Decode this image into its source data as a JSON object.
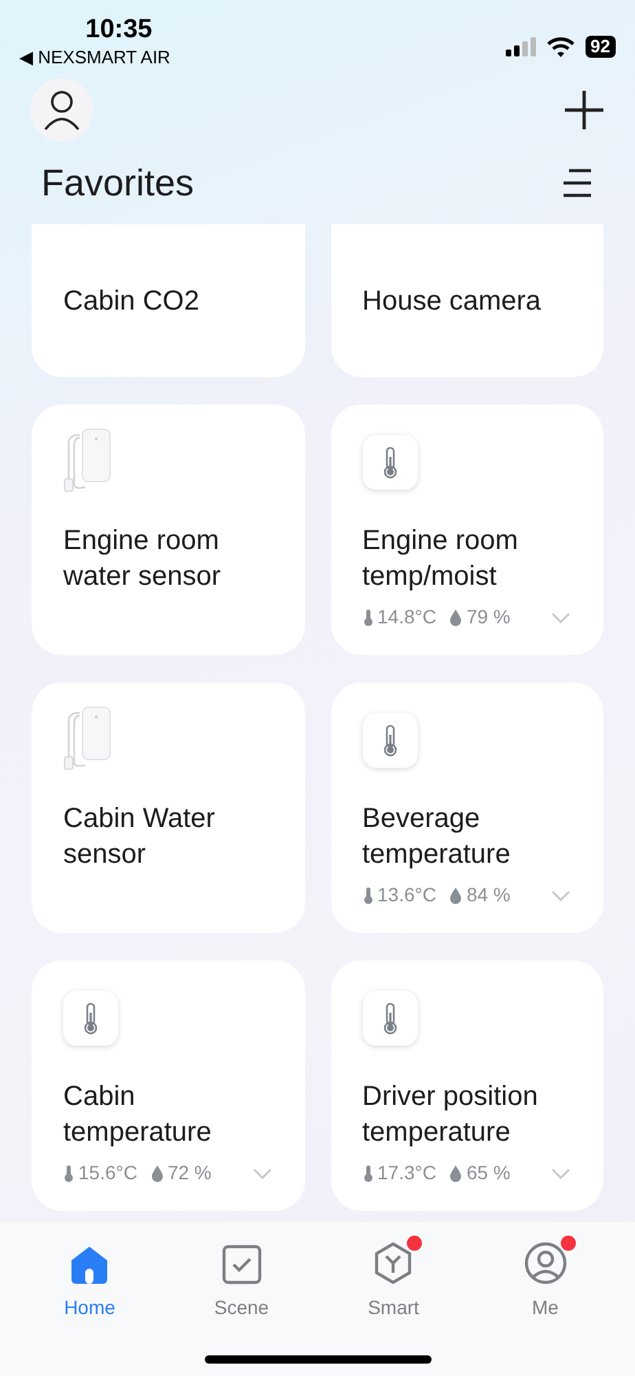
{
  "status_bar": {
    "time": "10:35",
    "back_label": "◀ NEXSMART AIR",
    "battery": "92"
  },
  "header": {
    "title": "Favorites"
  },
  "devices": [
    {
      "name": "Cabin CO2",
      "kind": "plain",
      "clipped": true
    },
    {
      "name": "House camera",
      "kind": "plain",
      "clipped": true
    },
    {
      "name": "Engine room water sensor",
      "kind": "water",
      "clipped": false
    },
    {
      "name": "Engine room temp/moist",
      "kind": "thermo",
      "clipped": false,
      "temperature": "14.8°C",
      "humidity": "79 %"
    },
    {
      "name": "Cabin Water sensor",
      "kind": "water",
      "clipped": false
    },
    {
      "name": "Beverage temperature",
      "kind": "thermo",
      "clipped": false,
      "temperature": "13.6°C",
      "humidity": "84 %"
    },
    {
      "name": "Cabin temperature",
      "kind": "thermo",
      "clipped": false,
      "temperature": "15.6°C",
      "humidity": "72 %"
    },
    {
      "name": "Driver position temperature",
      "kind": "thermo",
      "clipped": false,
      "temperature": "17.3°C",
      "humidity": "65 %"
    }
  ],
  "tabs": [
    {
      "label": "Home",
      "kind": "home",
      "selected": true,
      "badge": false
    },
    {
      "label": "Scene",
      "kind": "scene",
      "selected": false,
      "badge": false
    },
    {
      "label": "Smart",
      "kind": "smart",
      "selected": false,
      "badge": true
    },
    {
      "label": "Me",
      "kind": "me",
      "selected": false,
      "badge": true
    }
  ]
}
